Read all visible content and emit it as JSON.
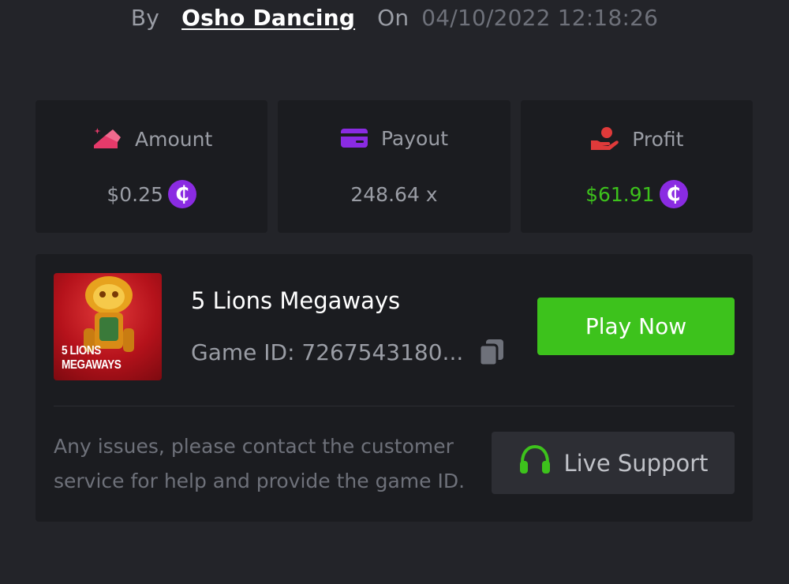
{
  "header": {
    "by_label": "By",
    "user_name": "Osho Dancing",
    "on_label": "On",
    "date": "04/10/2022 12:18:26"
  },
  "stats": {
    "amount": {
      "label": "Amount",
      "value": "$0.25",
      "icon": "bet-amount-icon",
      "icon_color": "#e53a6a"
    },
    "payout": {
      "label": "Payout",
      "value": "248.64 x",
      "icon": "card-icon",
      "icon_color": "#8a2be2"
    },
    "profit": {
      "label": "Profit",
      "value": "$61.91",
      "icon": "hand-coin-icon",
      "icon_color": "#e03a3a",
      "value_color": "#3dc21c"
    },
    "coin_symbol": "₵",
    "coin_color": "#8a2be2"
  },
  "game": {
    "thumb_line1": "5 LIONS",
    "thumb_line2": "MEGAWAYS",
    "name": "5 Lions Megaways",
    "id_text": "Game ID: 7267543180...",
    "play_label": "Play Now",
    "play_color": "#3dc21c"
  },
  "support": {
    "notice": "Any issues, please contact the customer service for help and provide the game ID.",
    "button_label": "Live Support",
    "icon": "headset-icon",
    "icon_color": "#3dc21c"
  }
}
